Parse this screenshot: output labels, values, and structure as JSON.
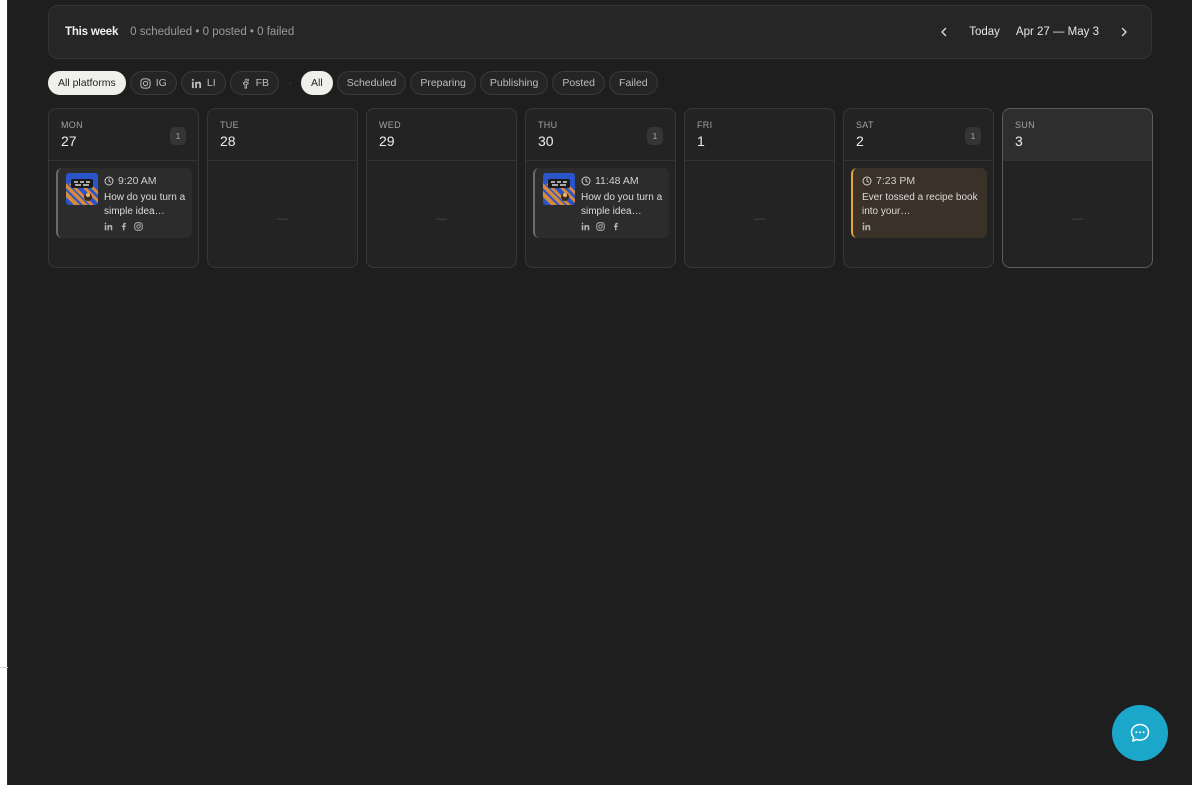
{
  "header": {
    "title": "This week",
    "stats": "0 scheduled • 0 posted • 0 failed",
    "today_label": "Today",
    "range": "Apr 27 — May 3"
  },
  "platform_filters": [
    {
      "label": "All platforms",
      "icon": "",
      "active": true
    },
    {
      "label": "IG",
      "icon": "instagram-icon",
      "active": false
    },
    {
      "label": "LI",
      "icon": "linkedin-icon",
      "active": false
    },
    {
      "label": "FB",
      "icon": "facebook-icon",
      "active": false
    }
  ],
  "separator": "·",
  "status_filters": [
    {
      "label": "All",
      "active": true
    },
    {
      "label": "Scheduled",
      "active": false
    },
    {
      "label": "Preparing",
      "active": false
    },
    {
      "label": "Publishing",
      "active": false
    },
    {
      "label": "Posted",
      "active": false
    },
    {
      "label": "Failed",
      "active": false
    }
  ],
  "days": [
    {
      "name": "MON",
      "num": "27",
      "count": "1",
      "post": {
        "time": "9:20 AM",
        "text": "How do you turn a simple idea…",
        "platforms": [
          "linkedin-icon",
          "facebook-icon",
          "instagram-icon"
        ],
        "thumb": true,
        "style": "gray"
      }
    },
    {
      "name": "TUE",
      "num": "28",
      "count": null,
      "empty": "—"
    },
    {
      "name": "WED",
      "num": "29",
      "count": null,
      "empty": "—"
    },
    {
      "name": "THU",
      "num": "30",
      "count": "1",
      "post": {
        "time": "11:48 AM",
        "text": "How do you turn a simple idea…",
        "platforms": [
          "linkedin-icon",
          "instagram-icon",
          "facebook-icon"
        ],
        "thumb": true,
        "style": "gray"
      }
    },
    {
      "name": "FRI",
      "num": "1",
      "count": null,
      "empty": "—"
    },
    {
      "name": "SAT",
      "num": "2",
      "count": "1",
      "post": {
        "time": "7:23 PM",
        "text": "Ever tossed a recipe book into your…",
        "platforms": [
          "linkedin-icon"
        ],
        "thumb": false,
        "style": "orange"
      }
    },
    {
      "name": "SUN",
      "num": "3",
      "count": null,
      "empty": "—",
      "is_today": true
    }
  ],
  "colors": {
    "background": "#1e1e1f",
    "accent_orange": "#e8a33a",
    "fab": "#1aa7c9"
  }
}
